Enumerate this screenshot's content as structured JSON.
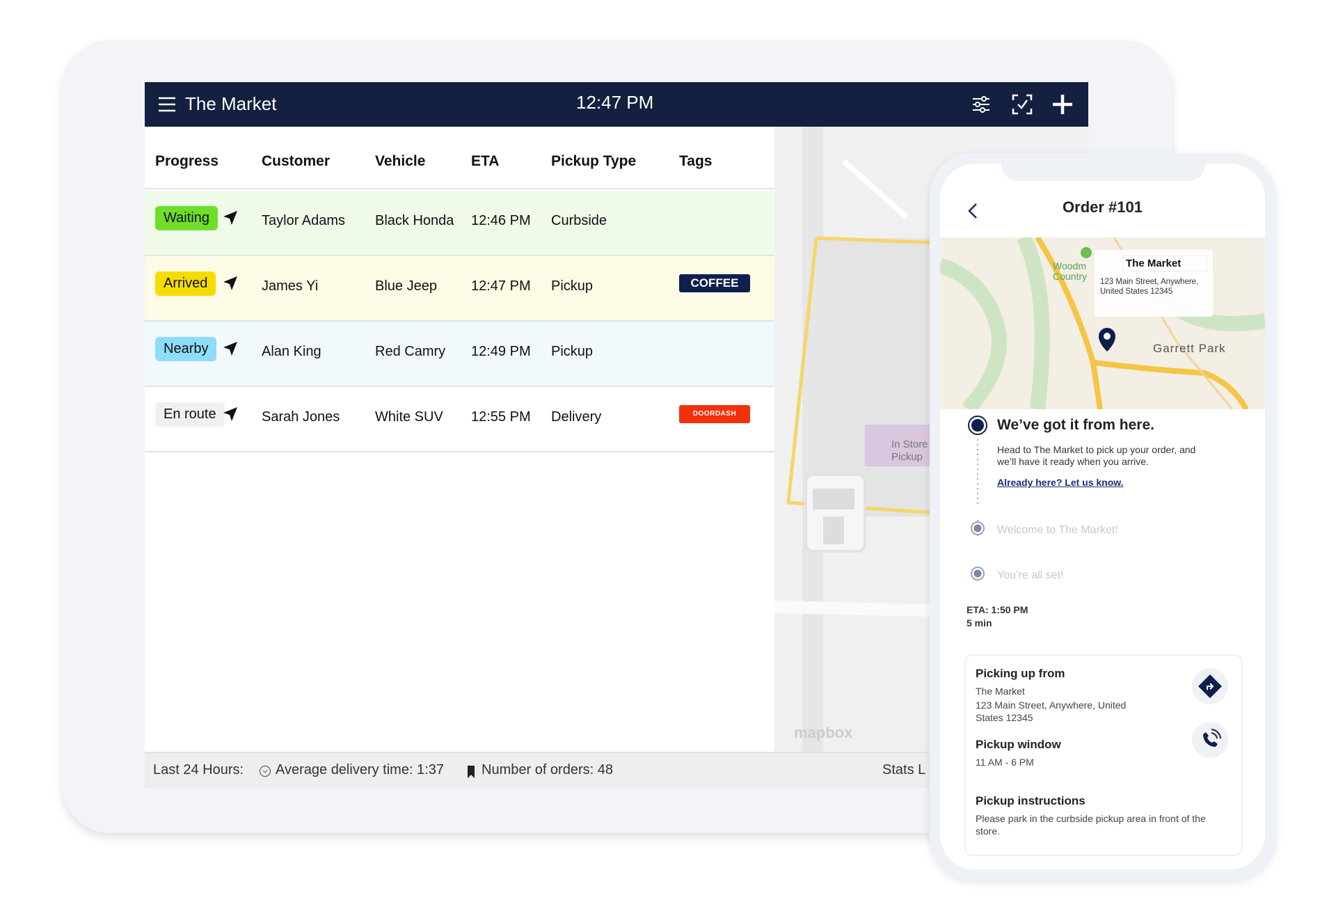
{
  "header": {
    "title": "The Market",
    "time": "12:47 PM",
    "icons": [
      "menu-icon",
      "filter-sliders-icon",
      "scan-check-icon",
      "plus-icon"
    ]
  },
  "table": {
    "columns": [
      "Progress",
      "Customer",
      "Vehicle",
      "ETA",
      "Pickup Type",
      "Tags"
    ],
    "rows": [
      {
        "progress": "Waiting",
        "customer": "Taylor Adams",
        "vehicle": "Black Honda",
        "eta": "12:46 PM",
        "pickup_type": "Curbside",
        "tag": "",
        "row_color": "#f0fae8",
        "badge_color": "#6ede2a"
      },
      {
        "progress": "Arrived",
        "customer": "James Yi",
        "vehicle": "Blue Jeep",
        "eta": "12:47 PM",
        "pickup_type": "Pickup",
        "tag": "COFFEE",
        "row_color": "#fdfbe6",
        "badge_color": "#f5dc00"
      },
      {
        "progress": "Nearby",
        "customer": "Alan King",
        "vehicle": "Red Camry",
        "eta": "12:49 PM",
        "pickup_type": "Pickup",
        "tag": "",
        "row_color": "#f2f9fd",
        "badge_color": "#8edcfa"
      },
      {
        "progress": "En route",
        "customer": "Sarah Jones",
        "vehicle": "White SUV",
        "eta": "12:55 PM",
        "pickup_type": "Delivery",
        "tag": "DOORDASH",
        "row_color": "#ffffff",
        "badge_color": "#f0f0f0"
      }
    ]
  },
  "map": {
    "label": "In Store Pickup",
    "attribution": "mapbox"
  },
  "footer": {
    "period": "Last 24 Hours:",
    "avg_delivery": "Average delivery time: 1:37",
    "orders": "Number of orders: 48",
    "stats": "Stats L"
  },
  "phone": {
    "title": "Order #101",
    "map": {
      "store_name": "The Market",
      "address": "123 Main Street, Anywhere, United States 12345",
      "place1": "Woodm Country",
      "place2": "Garrett Park"
    },
    "steps": [
      {
        "label": "We’ve got it from here.",
        "active": true
      },
      {
        "label": "Welcome to The Market!",
        "active": false
      },
      {
        "label": "You’re all set!",
        "active": false
      }
    ],
    "step_desc": "Head to The Market to pick up your order, and we’ll have it ready when you arrive.",
    "link": "Already here? Let us know.",
    "eta": "ETA: 1:50 PM",
    "eta_min": "5 min",
    "card": {
      "from_label": "Picking up from",
      "from_name": "The Market",
      "from_address": "123 Main Street, Anywhere, United States 12345",
      "window_label": "Pickup window",
      "window_value": "11 AM - 6 PM",
      "instr_label": "Pickup instructions",
      "instr_value": "Please park in the curbside pickup area in front of the store."
    }
  },
  "colors": {
    "header": "#13203f",
    "accent": "#0e1f4d",
    "doordash": "#f1300c"
  }
}
